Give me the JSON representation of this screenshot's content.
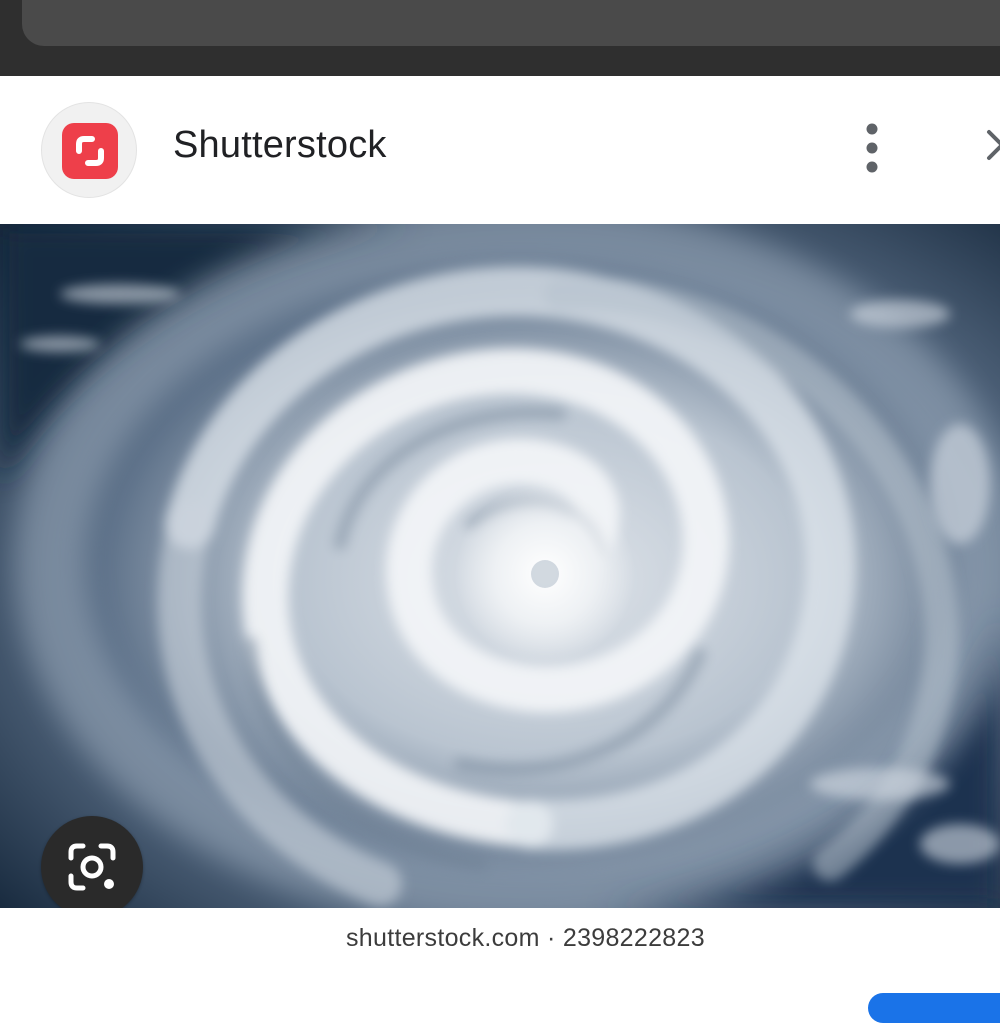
{
  "header": {
    "site_name": "Shutterstock",
    "logo_icon": "shutterstock-logo-icon",
    "more_icon": "more-vert-icon",
    "close_icon": "close-icon",
    "brand_color": "#ee3f4a"
  },
  "image": {
    "caption": "shutterstock.com · 2398222823"
  },
  "lens": {
    "icon": "lens-search-icon"
  }
}
